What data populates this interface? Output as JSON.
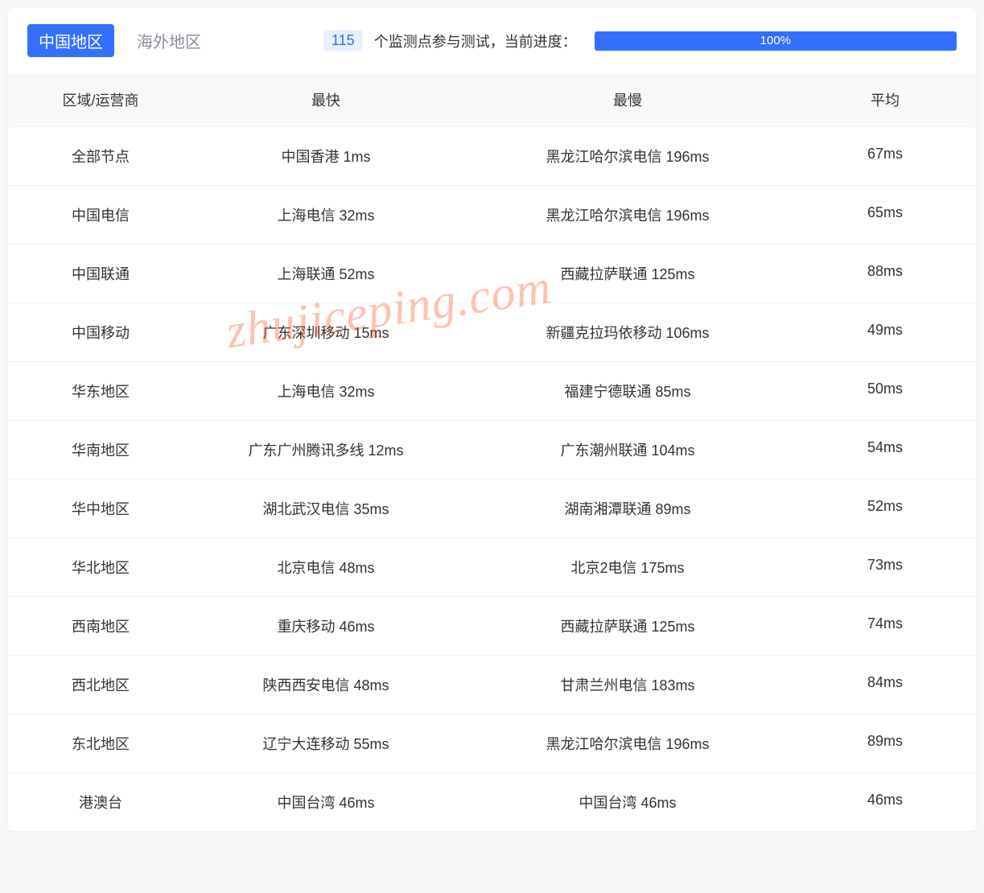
{
  "tabs": {
    "china": "中国地区",
    "overseas": "海外地区"
  },
  "monitor": {
    "count": "115",
    "text": "个监测点参与测试，当前进度：",
    "progress": "100%"
  },
  "columns": {
    "region": "区域/运营商",
    "fastest": "最快",
    "slowest": "最慢",
    "average": "平均"
  },
  "rows": [
    {
      "region": "全部节点",
      "fastest": "中国香港 1ms",
      "slowest": "黑龙江哈尔滨电信 196ms",
      "average": "67ms"
    },
    {
      "region": "中国电信",
      "fastest": "上海电信 32ms",
      "slowest": "黑龙江哈尔滨电信 196ms",
      "average": "65ms"
    },
    {
      "region": "中国联通",
      "fastest": "上海联通 52ms",
      "slowest": "西藏拉萨联通 125ms",
      "average": "88ms"
    },
    {
      "region": "中国移动",
      "fastest": "广东深圳移动 15ms",
      "slowest": "新疆克拉玛依移动 106ms",
      "average": "49ms"
    },
    {
      "region": "华东地区",
      "fastest": "上海电信 32ms",
      "slowest": "福建宁德联通 85ms",
      "average": "50ms"
    },
    {
      "region": "华南地区",
      "fastest": "广东广州腾讯多线 12ms",
      "slowest": "广东潮州联通 104ms",
      "average": "54ms"
    },
    {
      "region": "华中地区",
      "fastest": "湖北武汉电信 35ms",
      "slowest": "湖南湘潭联通 89ms",
      "average": "52ms"
    },
    {
      "region": "华北地区",
      "fastest": "北京电信 48ms",
      "slowest": "北京2电信 175ms",
      "average": "73ms"
    },
    {
      "region": "西南地区",
      "fastest": "重庆移动 46ms",
      "slowest": "西藏拉萨联通 125ms",
      "average": "74ms"
    },
    {
      "region": "西北地区",
      "fastest": "陕西西安电信 48ms",
      "slowest": "甘肃兰州电信 183ms",
      "average": "84ms"
    },
    {
      "region": "东北地区",
      "fastest": "辽宁大连移动 55ms",
      "slowest": "黑龙江哈尔滨电信 196ms",
      "average": "89ms"
    },
    {
      "region": "港澳台",
      "fastest": "中国台湾 46ms",
      "slowest": "中国台湾 46ms",
      "average": "46ms"
    }
  ],
  "watermark": "zhujiceping.com"
}
